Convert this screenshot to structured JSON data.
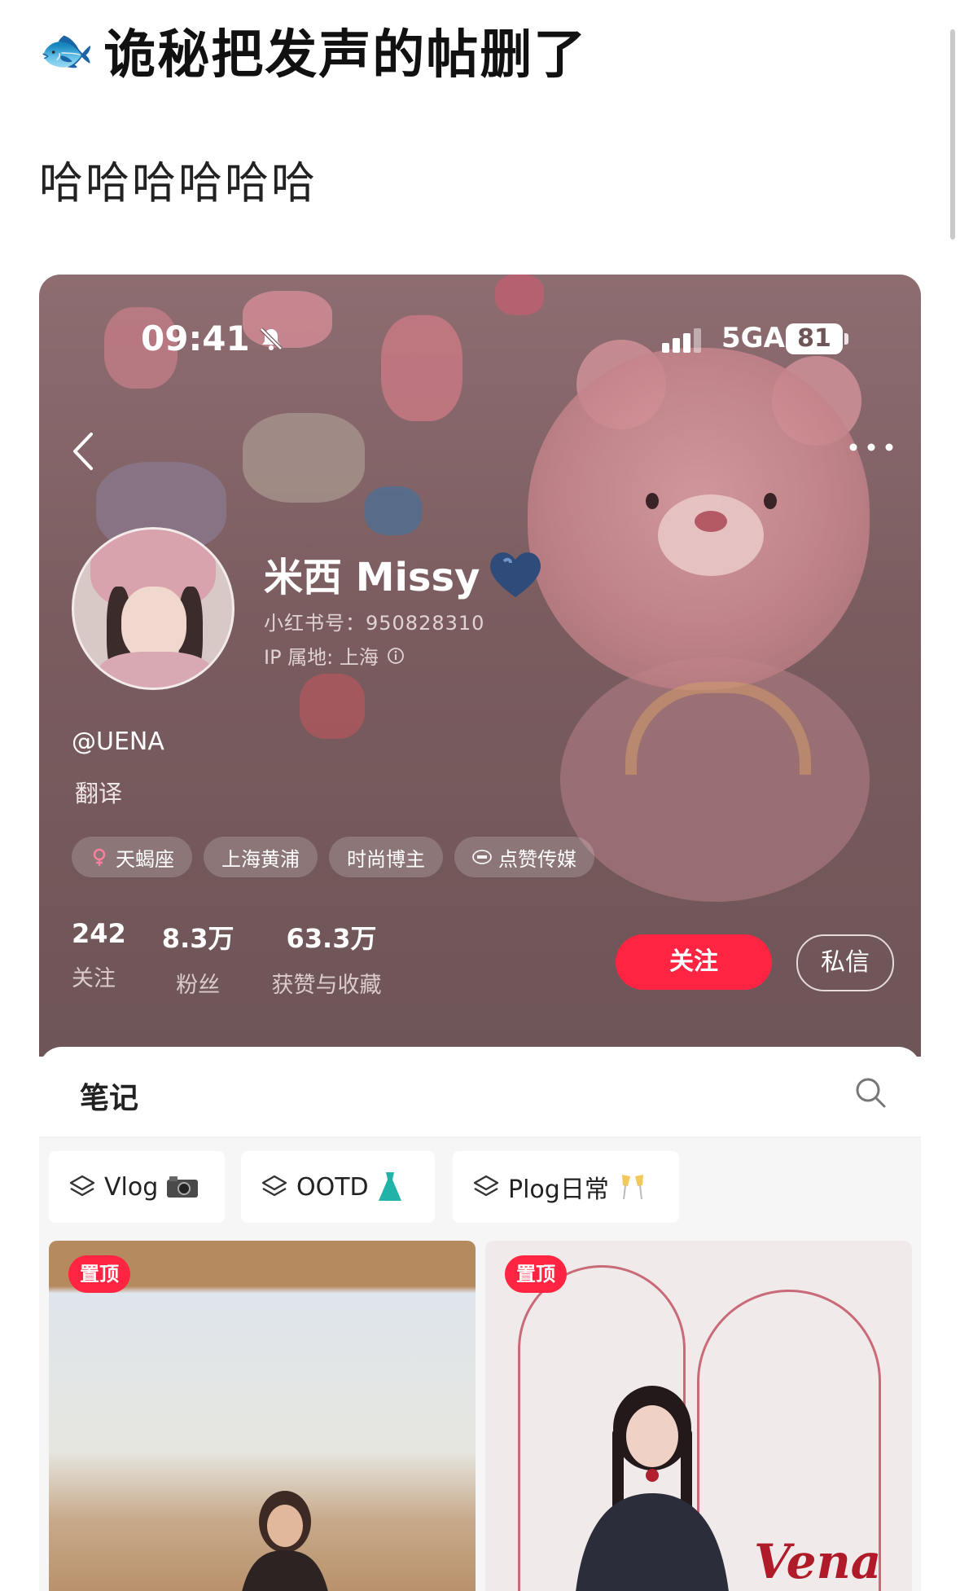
{
  "post": {
    "title_emoji": "🐟",
    "title": "诡秘把发声的帖删了",
    "body": "哈哈哈哈哈哈"
  },
  "status_bar": {
    "time": "09:41",
    "network": "5GA",
    "battery": "81"
  },
  "profile": {
    "nickname": "米西 Missy",
    "rednote_id": "小红书号：950828310",
    "ip_location": "IP 属地: 上海",
    "handle": "@UENA",
    "bio": "翻译",
    "tags": [
      {
        "label": "天蝎座",
        "icon": "female-icon"
      },
      {
        "label": "上海黄浦"
      },
      {
        "label": "时尚博主"
      },
      {
        "label": "点赞传媒",
        "icon": "mcn-icon"
      }
    ],
    "stats": [
      {
        "value": "242",
        "label": "关注"
      },
      {
        "value": "8.3万",
        "label": "粉丝"
      },
      {
        "value": "63.3万",
        "label": "获赞与收藏"
      }
    ],
    "follow_label": "关注",
    "dm_label": "私信"
  },
  "notes": {
    "tab_label": "笔记",
    "collections": [
      {
        "label": "Vlog",
        "icon": "camera-icon"
      },
      {
        "label": "OOTD",
        "icon": "dress-icon"
      },
      {
        "label": "Plog日常",
        "icon": "cheers-icon"
      }
    ],
    "cards": [
      {
        "badge": "置顶"
      },
      {
        "badge": "置顶",
        "watermark": "Vena"
      }
    ]
  },
  "colors": {
    "accent": "#ff2442",
    "profile_bg": "#7a5c5f"
  }
}
